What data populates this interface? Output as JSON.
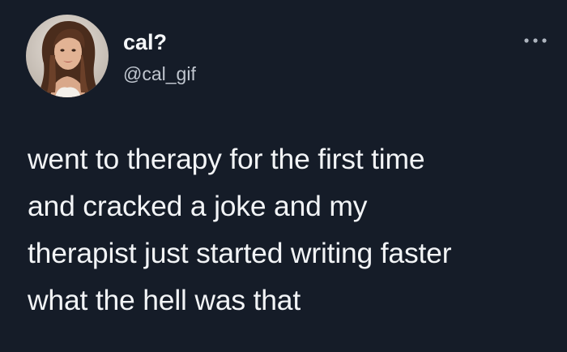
{
  "tweet": {
    "author": {
      "display_name": "cal?",
      "handle": "@cal_gif",
      "avatar_icon": "profile-photo"
    },
    "menu_icon": "more-horizontal-icon",
    "text": "went to therapy for the first time\nand cracked a joke and my\ntherapist just started writing faster\nwhat the hell was that"
  },
  "colors": {
    "background": "#151c28",
    "text": "#f2f4f6",
    "handle": "#c0c6cf"
  }
}
